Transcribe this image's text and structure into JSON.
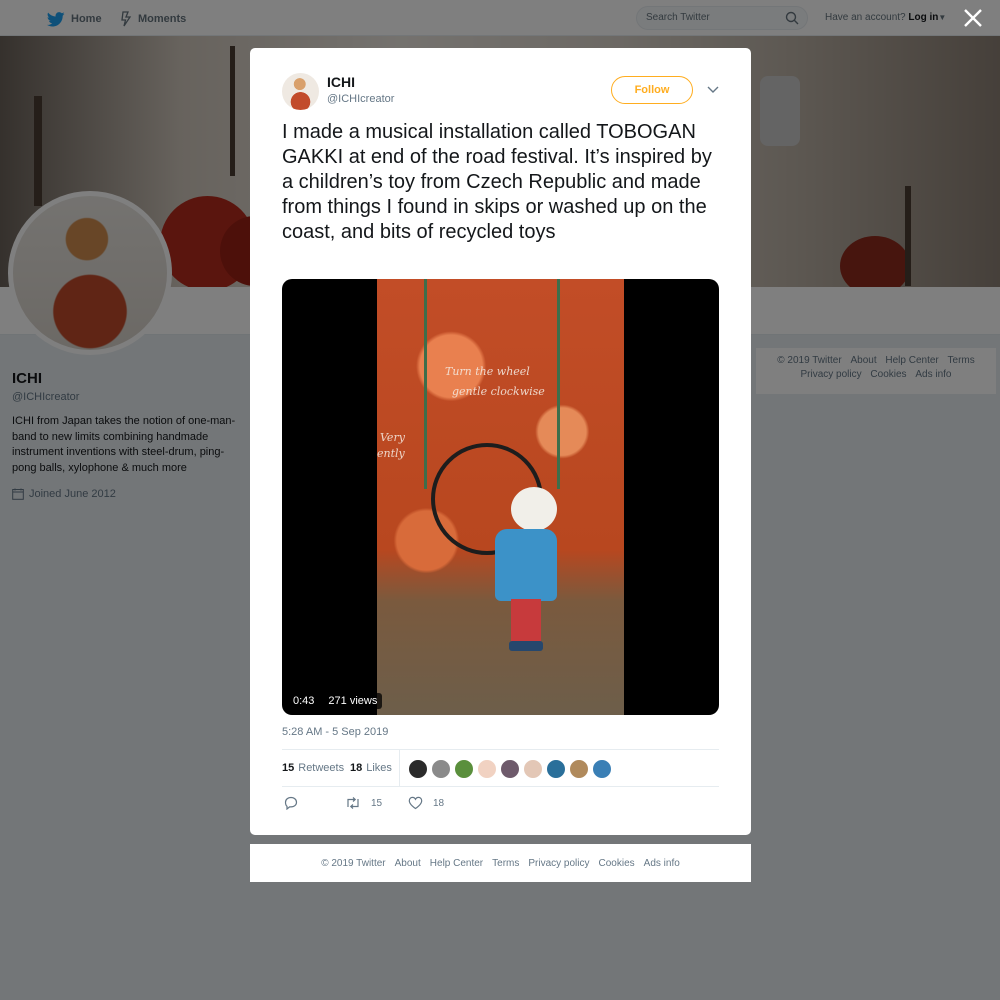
{
  "topbar": {
    "home_label": "Home",
    "moments_label": "Moments",
    "search_placeholder": "Search Twitter",
    "account_prompt": "Have an account?",
    "login_label": "Log in"
  },
  "profile": {
    "name": "ICHI",
    "handle": "@ICHIcreator",
    "bio": "ICHI from Japan takes the notion of one-man-band to new limits combining handmade instrument inventions with steel-drum, ping-pong balls, xylophone & much more",
    "joined": "Joined June 2012"
  },
  "side_footer": {
    "links": [
      "© 2019 Twitter",
      "About",
      "Help Center",
      "Terms",
      "Privacy policy",
      "Cookies",
      "Ads info"
    ]
  },
  "tweet": {
    "author_name": "ICHI",
    "author_handle": "@ICHIcreator",
    "follow_label": "Follow",
    "text": "I made a musical installation called TOBOGAN GAKKI at end of the road festival. It’s inspired by a children’s toy from Czech Republic and made from things I found in skips or washed up on the coast, and bits of recycled toys",
    "video": {
      "duration": "0:43",
      "views": "271 views",
      "chalk_line1": "Turn the wheel",
      "chalk_line2": "gentle clockwise",
      "chalk_line3": "Very",
      "chalk_line4": "ently"
    },
    "date": "5:28 AM - 5 Sep 2019",
    "retweets_count": "15",
    "retweets_label": "Retweets",
    "likes_count": "18",
    "likes_label": "Likes",
    "liker_colors": [
      "#2b2b2b",
      "#8a8a8a",
      "#5a8f3c",
      "#f1d2c2",
      "#6e5a6b",
      "#e3c7b6",
      "#2a6f9a",
      "#b08a5c",
      "#3a7fb5"
    ],
    "action_retweet_count": "15",
    "action_like_count": "18"
  },
  "modal_footer": {
    "copyright": "© 2019 Twitter",
    "about": "About",
    "help": "Help Center",
    "terms": "Terms",
    "privacy": "Privacy policy",
    "cookies": "Cookies",
    "ads": "Ads info"
  },
  "colors": {
    "accent": "#ffad1f",
    "link": "#657786",
    "twitter_blue": "#1da1f2"
  }
}
